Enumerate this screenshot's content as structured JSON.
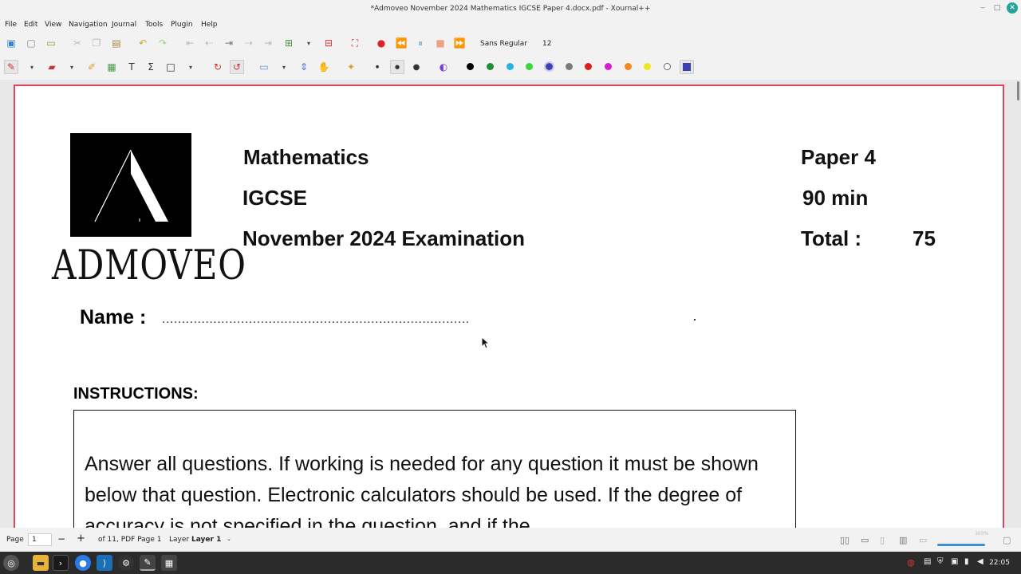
{
  "window": {
    "title": "*Admoveo November 2024 Mathematics IGCSE Paper 4.docx.pdf - Xournal++"
  },
  "menu": [
    "File",
    "Edit",
    "View",
    "Navigation",
    "Journal",
    "Tools",
    "Plugin",
    "Help"
  ],
  "toolbar": {
    "font_name": "Sans Regular",
    "font_size": "12"
  },
  "colors": {
    "accent": "#e0435a",
    "palette": [
      "#000000",
      "#1d8f2e",
      "#27b3e0",
      "#39d83a",
      "#3a3fb5",
      "#7a7a7a",
      "#e01b1b",
      "#d61bd6",
      "#f08a1f",
      "#f0e61f",
      "#ffffff",
      "#3a3fb5"
    ]
  },
  "document": {
    "logo_text": "ADMOVEO",
    "subject": "Mathematics",
    "level": "IGCSE",
    "exam": "November 2024 Examination",
    "paper": "Paper 4",
    "duration": "90 min",
    "total_label": "Total :",
    "total_value": "75",
    "name_label": "Name :",
    "name_dots": "..............................................................................",
    "instructions_title": "INSTRUCTIONS:",
    "instructions_text": "Answer all questions. If working is needed for any question it must be shown below that question. Electronic calculators should be used. If the degree of accuracy is not specified in the question, and if the"
  },
  "status": {
    "page_label": "Page",
    "page_value": "1",
    "page_of": "of 11, PDF Page 1",
    "layer_label": "Layer",
    "layer_value": "Layer 1",
    "zoom": "303%"
  },
  "taskbar": {
    "clock": "22:05"
  }
}
